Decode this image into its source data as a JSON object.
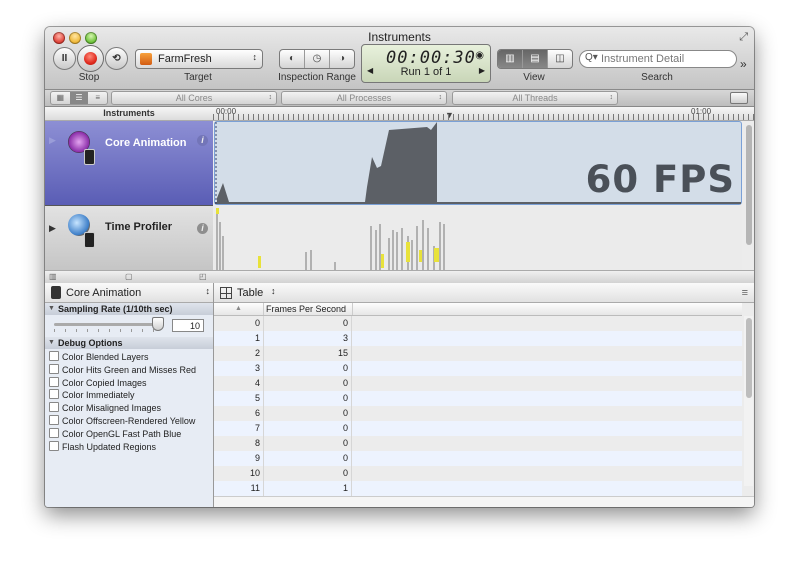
{
  "window": {
    "title": "Instruments"
  },
  "toolbar": {
    "pause_glyph": "II",
    "loop_glyph": "⟲",
    "stop_label": "Stop",
    "target_value": "FarmFresh",
    "target_arrows": "↕",
    "target_label": "Target",
    "inspection_range_label": "Inspection Range",
    "range_glyphs": [
      "◐",
      "◷",
      "◑"
    ],
    "timer": "00:00:30",
    "timer_prev_glyph": "◀",
    "timer_next_glyph": "▶",
    "timer_clock_glyph": "◉",
    "run_text": "Run 1 of 1",
    "view_label": "View",
    "search_placeholder": "Instrument Detail",
    "search_icon_glyph": "Q▾",
    "search_label": "Search",
    "overflow_glyph": "»",
    "fullscreen_glyph": "⤢"
  },
  "filters": {
    "cores": "All Cores",
    "processes": "All Processes",
    "threads": "All Threads",
    "arrow_glyph": "↕"
  },
  "timeline": {
    "instruments_header": "Instruments",
    "start_time": "00:00",
    "end_time": "01:00",
    "playhead_glyph": "▼",
    "fps_value": "60 FPS"
  },
  "tracks": [
    {
      "name": "Core Animation",
      "info_glyph": "i",
      "disclosure_glyph": "▶"
    },
    {
      "name": "Time Profiler",
      "info_glyph": "i",
      "disclosure_glyph": "▶"
    }
  ],
  "left_panel": {
    "instrument_select": "Core Animation",
    "select_arrows": "↕",
    "sampling_header": "Sampling Rate (1/10th sec)",
    "sampling_value": "10",
    "debug_header": "Debug Options",
    "section_glyph": "▼",
    "options": [
      "Color Blended Layers",
      "Color Hits Green and Misses Red",
      "Color Copied Images",
      "Color Immediately",
      "Color Misaligned Images",
      "Color Offscreen-Rendered Yellow",
      "Color OpenGL Fast Path Blue",
      "Flash Updated Regions"
    ]
  },
  "detail": {
    "view_select": "Table",
    "select_arrows": "↕",
    "menu_glyph": "≡",
    "sort_glyph": "▲",
    "column_header": "Frames Per Second",
    "rows": [
      {
        "index": "0",
        "fps": "0"
      },
      {
        "index": "1",
        "fps": "3"
      },
      {
        "index": "2",
        "fps": "15"
      },
      {
        "index": "3",
        "fps": "0"
      },
      {
        "index": "4",
        "fps": "0"
      },
      {
        "index": "5",
        "fps": "0"
      },
      {
        "index": "6",
        "fps": "0"
      },
      {
        "index": "7",
        "fps": "0"
      },
      {
        "index": "8",
        "fps": "0"
      },
      {
        "index": "9",
        "fps": "0"
      },
      {
        "index": "10",
        "fps": "0"
      },
      {
        "index": "11",
        "fps": "1"
      }
    ]
  }
}
